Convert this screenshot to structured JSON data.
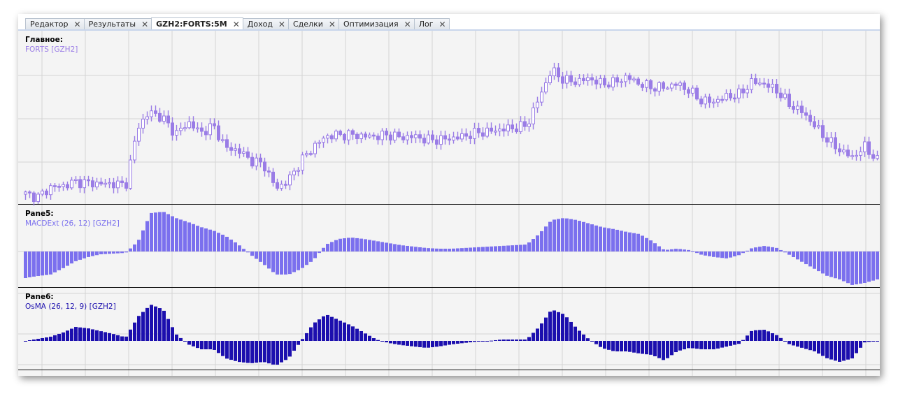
{
  "tabs": [
    {
      "label": "Редактор",
      "active": false
    },
    {
      "label": "Результаты",
      "active": false
    },
    {
      "label": "GZH2:FORTS:5M",
      "active": true
    },
    {
      "label": "Доход",
      "active": false
    },
    {
      "label": "Сделки",
      "active": false
    },
    {
      "label": "Оптимизация",
      "active": false
    },
    {
      "label": "Лог",
      "active": false
    }
  ],
  "close_glyph": "✕",
  "panes": [
    {
      "title": "Главное:",
      "indicator": "FORTS [GZH2]",
      "color": "#9a7ce6"
    },
    {
      "title": "Pane5:",
      "indicator": "MACDExt (26, 12) [GZH2]",
      "color": "#7b70ee"
    },
    {
      "title": "Pane6:",
      "indicator": "OsMA (26, 12, 9) [GZH2]",
      "color": "#1c0fae"
    }
  ],
  "chart_data": [
    {
      "type": "candlestick",
      "name": "FORTS [GZH2]",
      "close_trend": [
        34,
        30,
        44,
        46,
        52,
        50,
        49,
        49,
        47,
        132,
        152,
        142,
        120,
        137,
        122,
        132,
        100,
        97,
        82,
        77,
        42,
        54,
        82,
        102,
        117,
        119,
        119,
        117,
        117,
        119,
        115,
        117,
        112,
        112,
        114,
        117,
        122,
        124,
        127,
        129,
        132,
        172,
        212,
        197,
        195,
        200,
        192,
        194,
        202,
        192,
        187,
        187,
        192,
        182,
        167,
        167,
        174,
        177,
        195,
        192,
        182,
        162,
        152,
        132,
        112,
        97,
        87,
        102,
        82
      ]
    },
    {
      "type": "bar",
      "name": "MACDExt (26, 12)",
      "trend": [
        -38,
        -35,
        -33,
        -24,
        -14,
        -8,
        -4,
        -3,
        -2,
        15,
        55,
        57,
        48,
        42,
        35,
        30,
        22,
        10,
        -5,
        -18,
        -33,
        -33,
        -25,
        -12,
        10,
        18,
        20,
        18,
        15,
        12,
        9,
        7,
        5,
        4,
        4,
        5,
        6,
        7,
        8,
        9,
        10,
        25,
        45,
        48,
        45,
        40,
        35,
        32,
        28,
        25,
        15,
        2,
        4,
        2,
        -5,
        -8,
        -10,
        -5,
        5,
        8,
        5,
        -5,
        -15,
        -25,
        -35,
        -40,
        -48,
        -45,
        -40
      ]
    },
    {
      "type": "bar",
      "name": "OsMA (26, 12, 9)",
      "trend": [
        0,
        3,
        6,
        12,
        20,
        18,
        14,
        10,
        5,
        35,
        52,
        45,
        10,
        -5,
        -12,
        -12,
        -25,
        -30,
        -32,
        -30,
        -35,
        -25,
        0,
        25,
        38,
        30,
        22,
        12,
        2,
        -3,
        -6,
        -8,
        -10,
        -8,
        -5,
        -3,
        -1,
        0,
        2,
        2,
        2,
        20,
        45,
        38,
        18,
        2,
        -10,
        -15,
        -15,
        -18,
        -20,
        -28,
        -15,
        -10,
        -12,
        -12,
        -8,
        -4,
        15,
        16,
        8,
        -5,
        -10,
        -15,
        -25,
        -30,
        -25,
        -2,
        0
      ]
    }
  ]
}
